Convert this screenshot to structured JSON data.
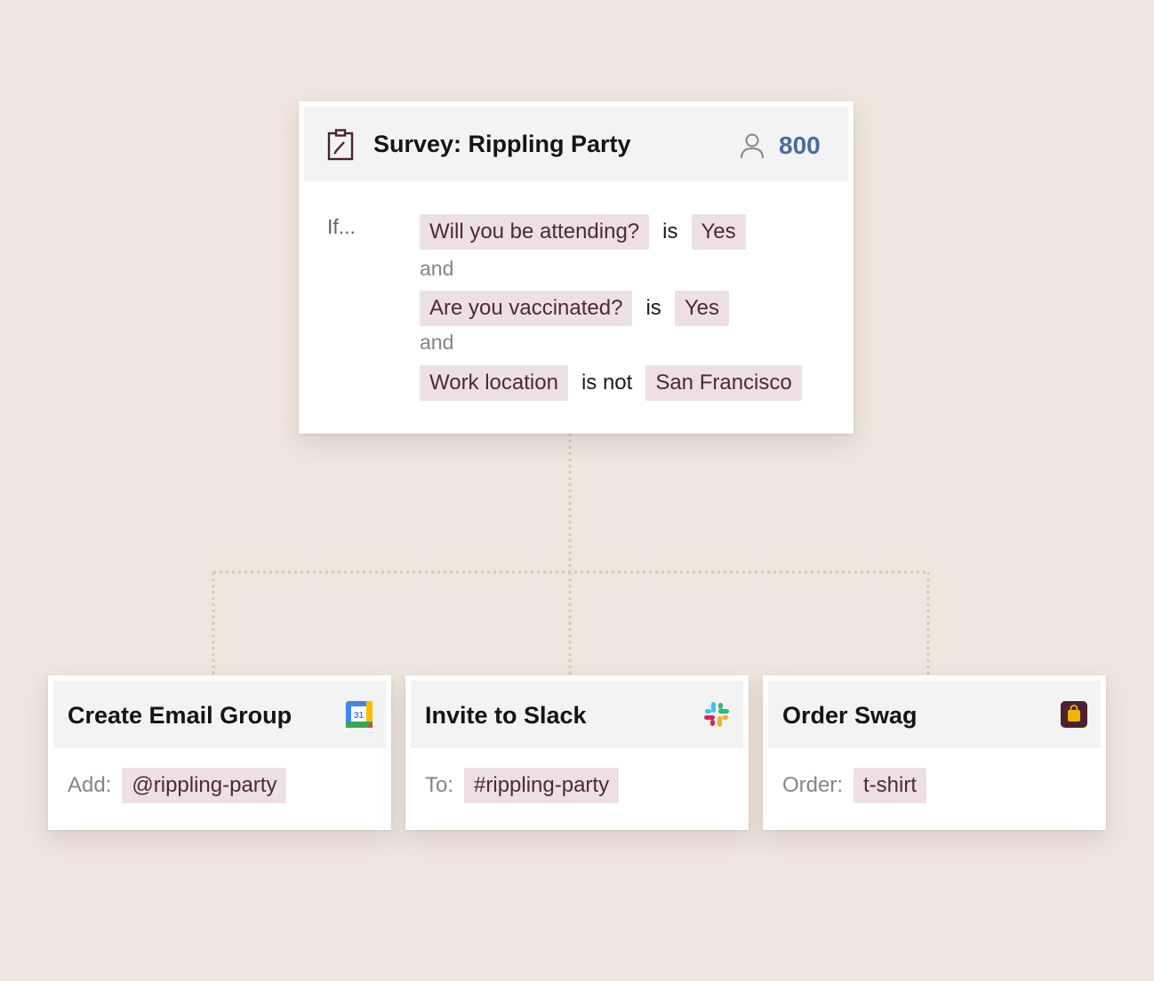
{
  "survey": {
    "title": "Survey: Rippling Party",
    "count": "800",
    "icon": "clipboard-icon",
    "count_icon": "person-icon",
    "if_label": "If...",
    "conditions": [
      {
        "field": "Will you be attending?",
        "operator": "is",
        "value": "Yes"
      },
      {
        "field": "Are you vaccinated?",
        "operator": "is",
        "value": "Yes"
      },
      {
        "field": "Work location",
        "operator": "is not",
        "value": "San Francisco"
      }
    ],
    "conjunctions": [
      "and",
      "and"
    ]
  },
  "actions": [
    {
      "title": "Create Email Group",
      "icon": "google-calendar-icon",
      "label": "Add:",
      "value": "@rippling-party"
    },
    {
      "title": "Invite to Slack",
      "icon": "slack-icon",
      "label": "To:",
      "value": "#rippling-party"
    },
    {
      "title": "Order Swag",
      "icon": "shopping-bag-icon",
      "label": "Order:",
      "value": "t-shirt"
    }
  ],
  "colors": {
    "background": "#efe6de",
    "chip_bg": "#ede0e3",
    "chip_text": "#4c2a36",
    "count_accent": "#4a6aa1",
    "connector": "#d8c7b3"
  }
}
